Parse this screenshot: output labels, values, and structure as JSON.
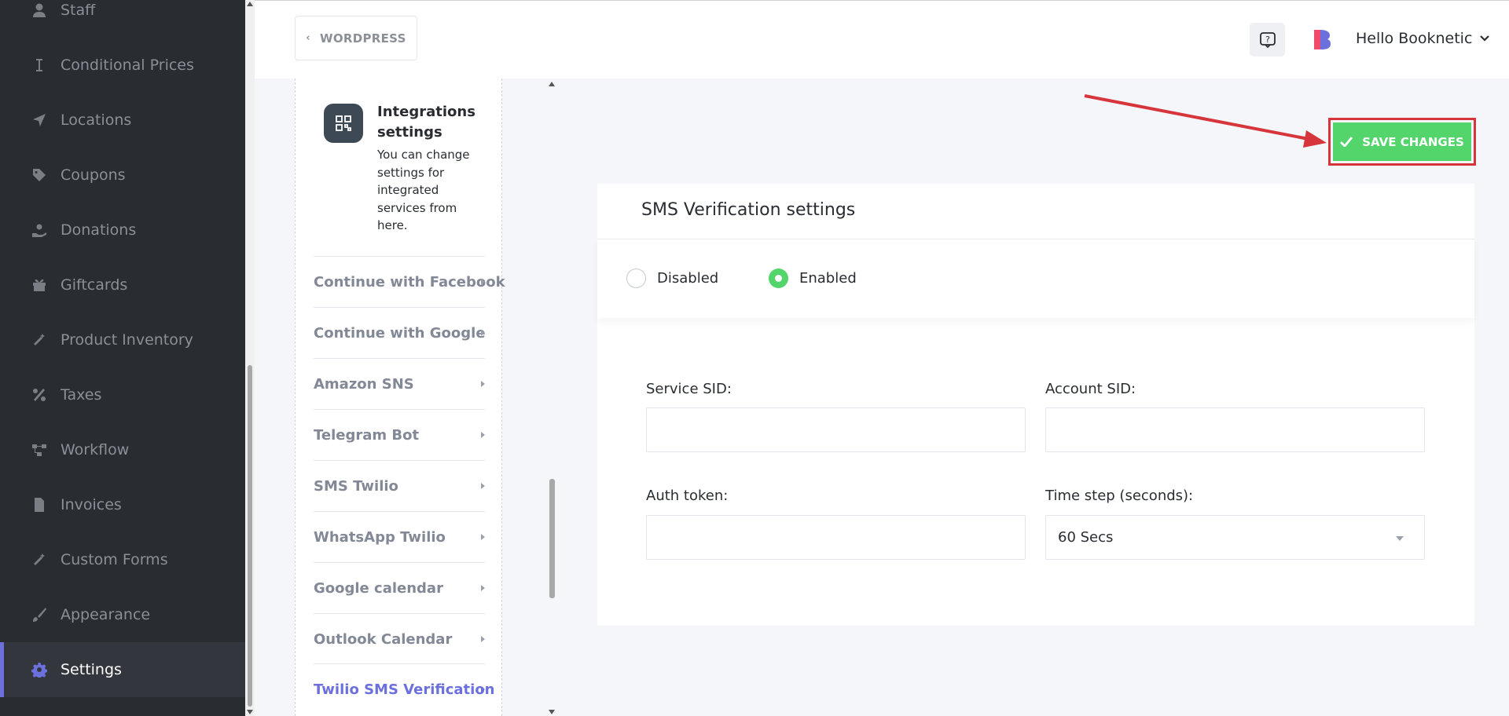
{
  "sidebar": {
    "items": [
      {
        "label": "Staff",
        "icon": "user-icon",
        "active": false
      },
      {
        "label": "Conditional Prices",
        "icon": "i-beam-icon",
        "active": false
      },
      {
        "label": "Locations",
        "icon": "location-arrow-icon",
        "active": false
      },
      {
        "label": "Coupons",
        "icon": "tag-icon",
        "active": false
      },
      {
        "label": "Donations",
        "icon": "hand-holding-icon",
        "active": false
      },
      {
        "label": "Giftcards",
        "icon": "gift-icon",
        "active": false
      },
      {
        "label": "Product Inventory",
        "icon": "magic-wand-icon",
        "active": false
      },
      {
        "label": "Taxes",
        "icon": "percent-icon",
        "active": false
      },
      {
        "label": "Workflow",
        "icon": "workflow-icon",
        "active": false
      },
      {
        "label": "Invoices",
        "icon": "file-icon",
        "active": false
      },
      {
        "label": "Custom Forms",
        "icon": "magic-wand-icon",
        "active": false
      },
      {
        "label": "Appearance",
        "icon": "brush-icon",
        "active": false
      },
      {
        "label": "Settings",
        "icon": "gear-icon",
        "active": true
      }
    ]
  },
  "header": {
    "back_label": "WORDPRESS",
    "greeting": "Hello Booknetic"
  },
  "integrations": {
    "title": "Integrations settings",
    "description": "You can change settings for integrated services from here.",
    "items": [
      {
        "label": "Continue with Facebook",
        "active": false
      },
      {
        "label": "Continue with Google",
        "active": false
      },
      {
        "label": "Amazon SNS",
        "active": false
      },
      {
        "label": "Telegram Bot",
        "active": false
      },
      {
        "label": "SMS Twilio",
        "active": false
      },
      {
        "label": "WhatsApp Twilio",
        "active": false
      },
      {
        "label": "Google calendar",
        "active": false
      },
      {
        "label": "Outlook Calendar",
        "active": false
      },
      {
        "label": "Twilio SMS Verification",
        "active": true
      }
    ]
  },
  "toolbar": {
    "save_label": "SAVE CHANGES"
  },
  "sms": {
    "title": "SMS Verification settings",
    "radio_disabled": "Disabled",
    "radio_enabled": "Enabled",
    "selected": "Enabled",
    "service_sid_label": "Service SID:",
    "service_sid_value": "",
    "account_sid_label": "Account SID:",
    "account_sid_value": "",
    "auth_token_label": "Auth token:",
    "auth_token_value": "",
    "time_step_label": "Time step (seconds):",
    "time_step_value": "60 Secs"
  },
  "colors": {
    "accent": "#6c70dc",
    "save_green": "#53d56c",
    "highlight_red": "#d6363b",
    "sidebar_bg": "#292d32"
  }
}
